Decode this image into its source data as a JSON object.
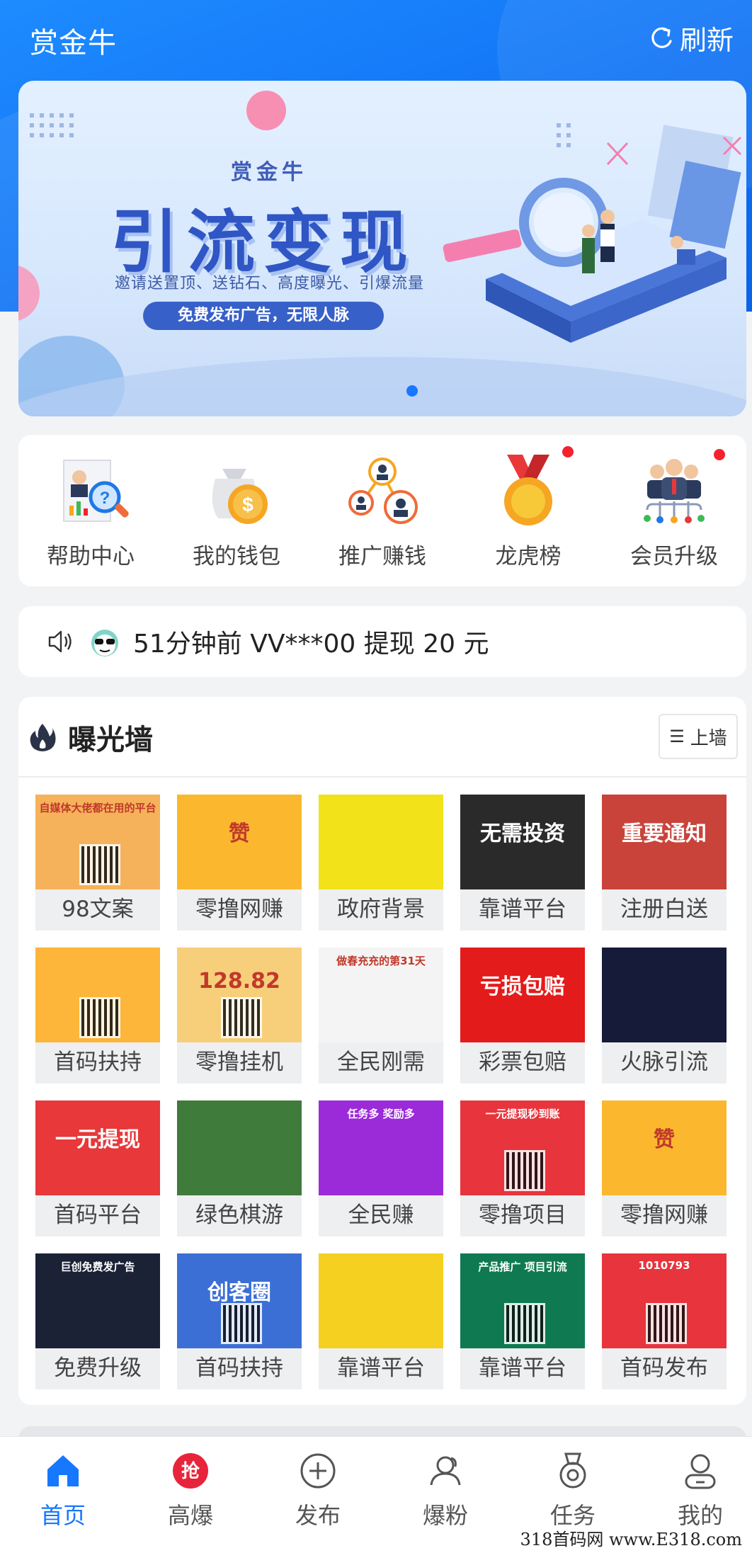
{
  "header": {
    "title": "赏金牛",
    "refresh_label": "刷新"
  },
  "banner": {
    "subtitle": "赏金牛",
    "headline": "引流变现",
    "desc": "邀请送置顶、送钻石、高度曝光、引爆流量",
    "pill": "免费发布广告，无限人脉",
    "page_indicator": "1"
  },
  "menu": [
    {
      "label": "帮助中心",
      "icon": "help-center-icon",
      "badge": false
    },
    {
      "label": "我的钱包",
      "icon": "wallet-icon",
      "badge": false
    },
    {
      "label": "推广赚钱",
      "icon": "promote-icon",
      "badge": false
    },
    {
      "label": "龙虎榜",
      "icon": "medal-icon",
      "badge": true
    },
    {
      "label": "会员升级",
      "icon": "member-icon",
      "badge": true
    }
  ],
  "notice": {
    "text": "51分钟前 VV***00 提现 20 元"
  },
  "wall": {
    "title": "曝光墙",
    "button": "上墙",
    "tiles": [
      {
        "label": "98文案",
        "bg": "#f6b25a",
        "img_text": "自媒体大佬都在用的平台"
      },
      {
        "label": "零撸网赚",
        "bg": "#fbb82e",
        "img_text": "赞"
      },
      {
        "label": "政府背景",
        "bg": "#f2e21a",
        "img_text": ""
      },
      {
        "label": "靠谱平台",
        "bg": "#2a2a2a",
        "img_text": "无需投资"
      },
      {
        "label": "注册白送",
        "bg": "#c9433a",
        "img_text": "重要通知"
      },
      {
        "label": "首码扶持",
        "bg": "#fdb53a",
        "img_text": ""
      },
      {
        "label": "零撸挂机",
        "bg": "#f7cf7a",
        "img_text": "128.82"
      },
      {
        "label": "全民刚需",
        "bg": "#f4f4f4",
        "img_text": "做春充充的第31天"
      },
      {
        "label": "彩票包赔",
        "bg": "#e31b1b",
        "img_text": "亏损包赔"
      },
      {
        "label": "火脉引流",
        "bg": "#161b3a",
        "img_text": ""
      },
      {
        "label": "首码平台",
        "bg": "#e8383a",
        "img_text": "一元提现"
      },
      {
        "label": "绿色棋游",
        "bg": "#3f7b3a",
        "img_text": ""
      },
      {
        "label": "全民赚",
        "bg": "#9b2bd9",
        "img_text": "任务多 奖励多"
      },
      {
        "label": "零撸项目",
        "bg": "#e8343c",
        "img_text": "一元提现秒到账"
      },
      {
        "label": "零撸网赚",
        "bg": "#fbb82e",
        "img_text": "赞"
      },
      {
        "label": "免费升级",
        "bg": "#1b2236",
        "img_text": "巨创免费发广告"
      },
      {
        "label": "首码扶持",
        "bg": "#3c6fd6",
        "img_text": "创客圈"
      },
      {
        "label": "靠谱平台",
        "bg": "#f5d020",
        "img_text": ""
      },
      {
        "label": "靠谱平台",
        "bg": "#0f7a52",
        "img_text": "产品推广 项目引流"
      },
      {
        "label": "首码发布",
        "bg": "#e8343c",
        "img_text": "1010793"
      }
    ]
  },
  "tabs": [
    {
      "label": "首页",
      "icon": "home-icon",
      "active": true
    },
    {
      "label": "高爆",
      "icon": "grab-icon",
      "active": false
    },
    {
      "label": "发布",
      "icon": "plus-circle-icon",
      "active": false
    },
    {
      "label": "爆粉",
      "icon": "users-icon",
      "active": false
    },
    {
      "label": "任务",
      "icon": "badge-icon",
      "active": false
    },
    {
      "label": "我的",
      "icon": "profile-icon",
      "active": false
    }
  ],
  "watermark": "318首码网 www.E318.com",
  "colors": {
    "primary": "#1677ff",
    "header_blue": "#1274f5",
    "badge_red": "#f5222d"
  }
}
